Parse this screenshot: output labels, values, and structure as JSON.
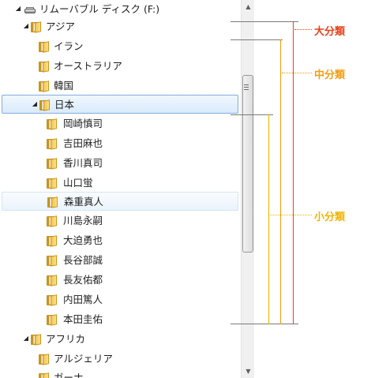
{
  "tree": {
    "items": [
      {
        "label": "リムーバブル ディスク (F:)",
        "icon": "drive-icon",
        "expander": "expanded"
      },
      {
        "label": "アジア",
        "icon": "folder-icon",
        "expander": "expanded"
      },
      {
        "label": "イラン",
        "icon": "folder-icon",
        "expander": "none"
      },
      {
        "label": "オーストラリア",
        "icon": "folder-icon",
        "expander": "none"
      },
      {
        "label": "韓国",
        "icon": "folder-icon",
        "expander": "none"
      },
      {
        "label": "日本",
        "icon": "folder-icon",
        "expander": "expanded",
        "state": "selected"
      },
      {
        "label": "岡崎慎司",
        "icon": "folder-icon",
        "expander": "none"
      },
      {
        "label": "吉田麻也",
        "icon": "folder-icon",
        "expander": "none"
      },
      {
        "label": "香川真司",
        "icon": "folder-icon",
        "expander": "none"
      },
      {
        "label": "山口蛍",
        "icon": "folder-icon",
        "expander": "none"
      },
      {
        "label": "森重真人",
        "icon": "folder-icon",
        "expander": "none",
        "state": "hover"
      },
      {
        "label": "川島永嗣",
        "icon": "folder-icon",
        "expander": "none"
      },
      {
        "label": "大迫勇也",
        "icon": "folder-icon",
        "expander": "none"
      },
      {
        "label": "長谷部誠",
        "icon": "folder-icon",
        "expander": "none"
      },
      {
        "label": "長友佑都",
        "icon": "folder-icon",
        "expander": "none"
      },
      {
        "label": "内田篤人",
        "icon": "folder-icon",
        "expander": "none"
      },
      {
        "label": "本田圭佑",
        "icon": "folder-icon",
        "expander": "none"
      },
      {
        "label": "アフリカ",
        "icon": "folder-icon",
        "expander": "expanded"
      },
      {
        "label": "アルジェリア",
        "icon": "folder-icon",
        "expander": "none"
      },
      {
        "label": "ガーナ",
        "icon": "folder-icon",
        "expander": "none"
      }
    ]
  },
  "scrollbar": {
    "up_arrow": "▲",
    "down_arrow": "▼"
  },
  "annotations": {
    "major": {
      "label": "大分類",
      "color": "#e8401c"
    },
    "middle": {
      "label": "中分類",
      "color": "#f39c12"
    },
    "minor": {
      "label": "小分類",
      "color": "#f0b400"
    }
  },
  "colors": {
    "selection_border": "#84acdd",
    "folder": "#f2c54a"
  }
}
